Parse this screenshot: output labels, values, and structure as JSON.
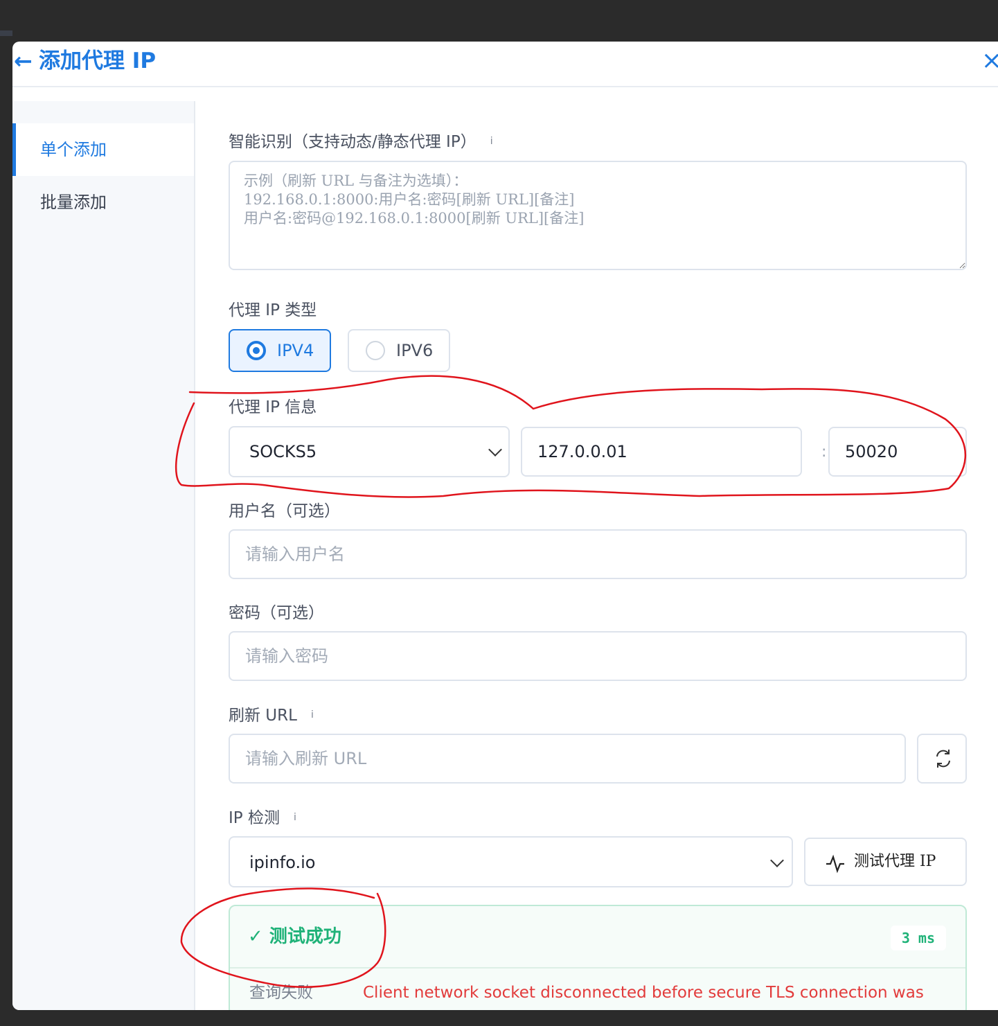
{
  "header": {
    "back_icon": "←",
    "title": "添加代理 IP",
    "close_icon": "×"
  },
  "sidebar": {
    "items": [
      {
        "label": "单个添加",
        "active": true
      },
      {
        "label": "批量添加",
        "active": false
      }
    ]
  },
  "smart": {
    "label": "智能识别（支持动态/静态代理 IP）",
    "info": "i",
    "placeholder": "示例（刷新 URL 与备注为选填）：\n192.168.0.1:8000:用户名:密码[刷新 URL][备注]\n用户名:密码@192.168.0.1:8000[刷新 URL][备注]"
  },
  "ip_type": {
    "label": "代理 IP 类型",
    "options": [
      "IPV4",
      "IPV6"
    ],
    "selected": "IPV4"
  },
  "ip_info": {
    "label": "代理 IP 信息",
    "protocol": "SOCKS5",
    "host": "127.0.0.01",
    "colon": ":",
    "port": "50020"
  },
  "username": {
    "label": "用户名（可选）",
    "placeholder": "请输入用户名"
  },
  "password": {
    "label": "密码（可选）",
    "placeholder": "请输入密码"
  },
  "refresh": {
    "label": "刷新 URL",
    "info": "i",
    "placeholder": "请输入刷新 URL"
  },
  "check": {
    "label": "IP 检测",
    "info": "i",
    "service": "ipinfo.io",
    "test_button": "测试代理 IP"
  },
  "result": {
    "check_icon": "✓",
    "status": "测试成功",
    "latency": "3 ms",
    "row_label": "查询失败",
    "error": "Client network socket disconnected before secure TLS connection was"
  },
  "colors": {
    "accent": "#1f7ae0",
    "success": "#1fb278",
    "error": "#e23b3b",
    "annotation": "#e0141c"
  }
}
